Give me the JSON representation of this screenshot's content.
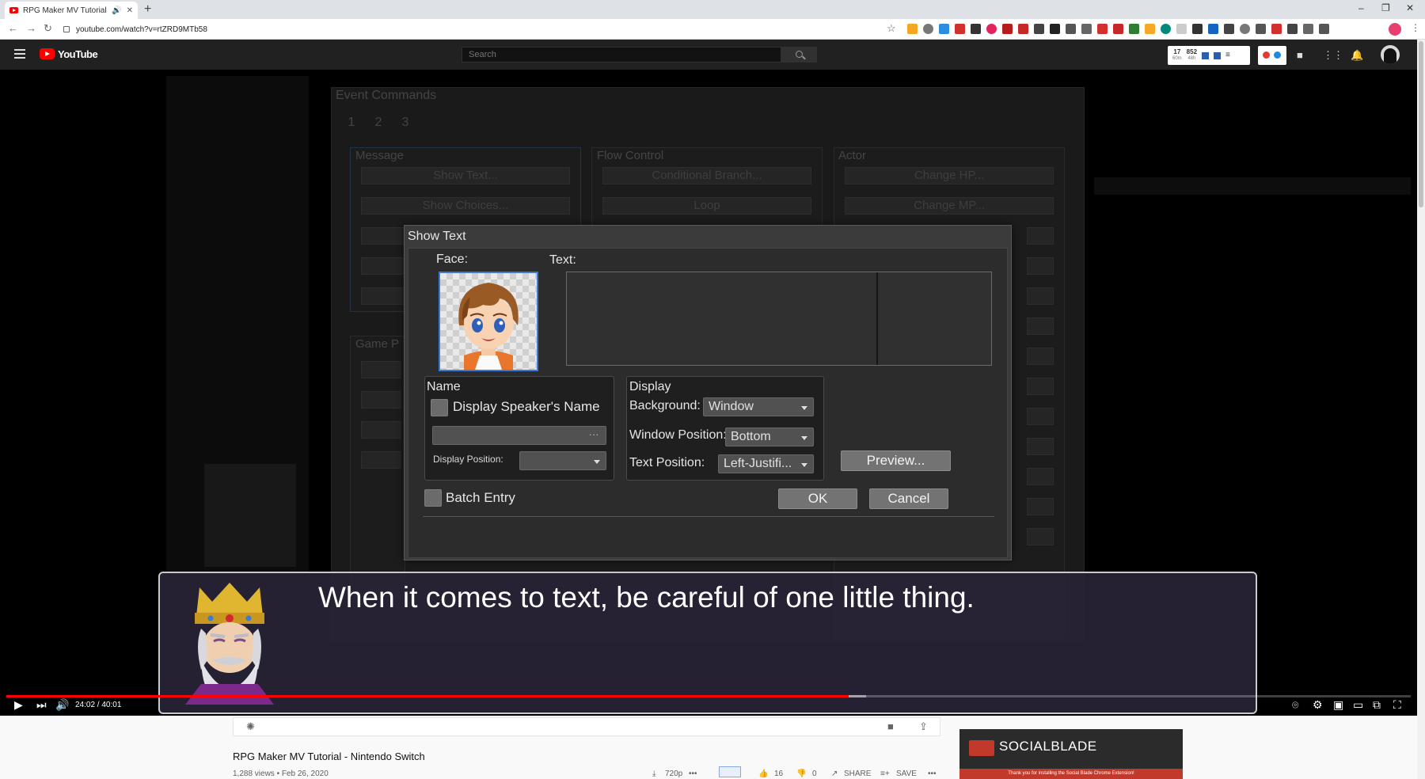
{
  "browser": {
    "tab_title": "RPG Maker MV Tutorial - Ni",
    "tab_audio": "🔊",
    "tab_close": "✕",
    "new_tab": "+",
    "url": "youtube.com/watch?v=rtZRD9MTb58",
    "minimize": "–",
    "restore": "❐",
    "close": "✕"
  },
  "youtube": {
    "logo": "YouTube",
    "search_placeholder": "Search",
    "socialblade_stats": {
      "a": "17",
      "a_sub": "60m",
      "b": "852",
      "b_sub": "48h"
    }
  },
  "video_bg": {
    "title": "Event Commands",
    "tabs": [
      "1",
      "2",
      "3"
    ],
    "groups": {
      "message": "Message",
      "flow": "Flow Control",
      "actor": "Actor",
      "game": "Game P"
    },
    "buttons": {
      "show_text": "Show Text...",
      "show_choices": "Show Choices...",
      "conditional": "Conditional Branch...",
      "loop": "Loop",
      "change_hp": "Change HP...",
      "change_mp": "Change MP..."
    }
  },
  "dialog": {
    "title": "Show Text",
    "face_label": "Face:",
    "text_label": "Text:",
    "name_group": "Name",
    "display_speaker": "Display Speaker's Name",
    "display_position_label": "Display Position:",
    "display_group": "Display",
    "background_label": "Background:",
    "background_value": "Window",
    "window_position_label": "Window Position:",
    "window_position_value": "Bottom",
    "text_position_label": "Text Position:",
    "text_position_value": "Left-Justifi...",
    "preview": "Preview...",
    "batch_entry": "Batch Entry",
    "ok": "OK",
    "cancel": "Cancel"
  },
  "game_message": {
    "text": "When it comes to text, be careful of one little thing."
  },
  "player": {
    "time": "24:02 / 40:01",
    "played_fraction": 0.6
  },
  "below": {
    "video_title": "RPG Maker MV Tutorial - Nintendo Switch",
    "views": "1,288 views • Feb 26, 2020",
    "quality": "720p",
    "likes": "16",
    "dislikes": "0",
    "share": "SHARE",
    "save": "SAVE",
    "more": "•••"
  },
  "socialblade": {
    "name": "SOCIALBLADE",
    "strip": "Thank you for installing the Social Blade Chrome Extension!"
  },
  "colors": {
    "progress_played": "#ff0000",
    "face_border": "#3b7ad6",
    "youtube_red": "#ff0000"
  }
}
